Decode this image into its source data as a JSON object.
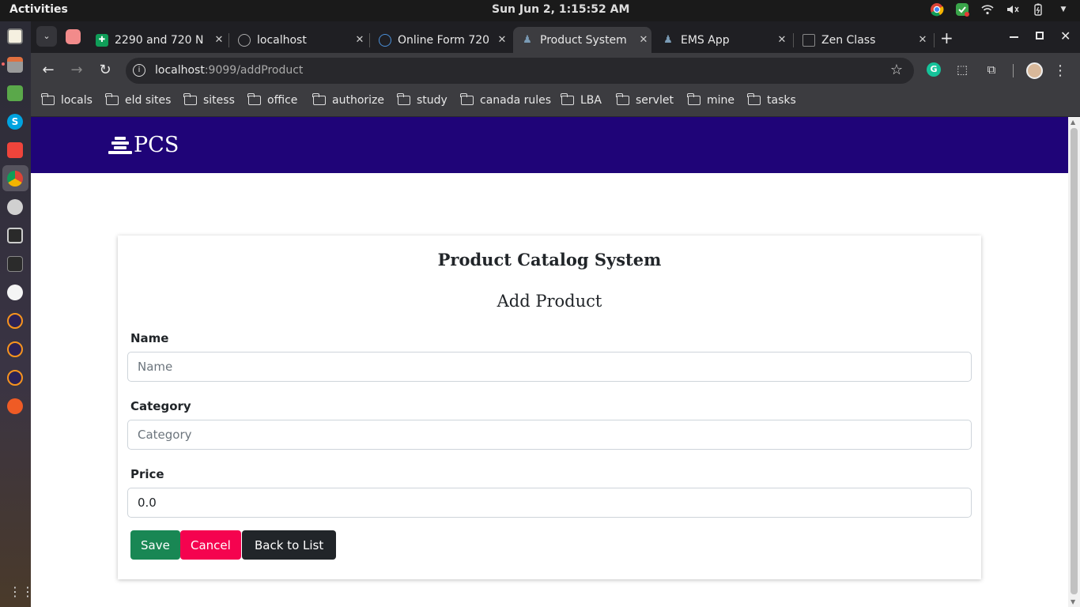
{
  "os": {
    "activities_label": "Activities",
    "clock": "Sun Jun  2,  1:15:52 AM"
  },
  "browser": {
    "tabs": [
      {
        "title": "2290 and 720 N",
        "favicon": "sheets-icon",
        "color": "#0f9d58"
      },
      {
        "title": "localhost",
        "favicon": "globe-icon",
        "color": "#888888"
      },
      {
        "title": "Online Form 720",
        "favicon": "form-icon",
        "color": "#4a8fd8"
      },
      {
        "title": "Product System",
        "favicon": "app-icon",
        "color": "#7a9bb5"
      },
      {
        "title": "EMS App",
        "favicon": "app-icon",
        "color": "#7a9bb5"
      },
      {
        "title": "Zen Class",
        "favicon": "page-icon",
        "color": "#888888"
      }
    ],
    "active_tab": 3,
    "address": {
      "host": "localhost",
      "rest": ":9099/addProduct"
    },
    "bookmarks": [
      "locals",
      "eld sites",
      "sitess",
      "office",
      "authorize",
      "study",
      "canada rules",
      "LBA",
      "servlet",
      "mine",
      "tasks"
    ]
  },
  "page": {
    "brand": "PCS",
    "brand_color": "#1f0478",
    "heading": "Product Catalog System",
    "subheading": "Add Product",
    "form": {
      "name_label": "Name",
      "name_placeholder": "Name",
      "category_label": "Category",
      "category_placeholder": "Category",
      "price_label": "Price",
      "price_value": "0.0"
    },
    "buttons": {
      "save": "Save",
      "cancel": "Cancel",
      "back": "Back to List"
    },
    "colors": {
      "save": "#198754",
      "cancel": "#f5034f",
      "back": "#212529"
    }
  }
}
